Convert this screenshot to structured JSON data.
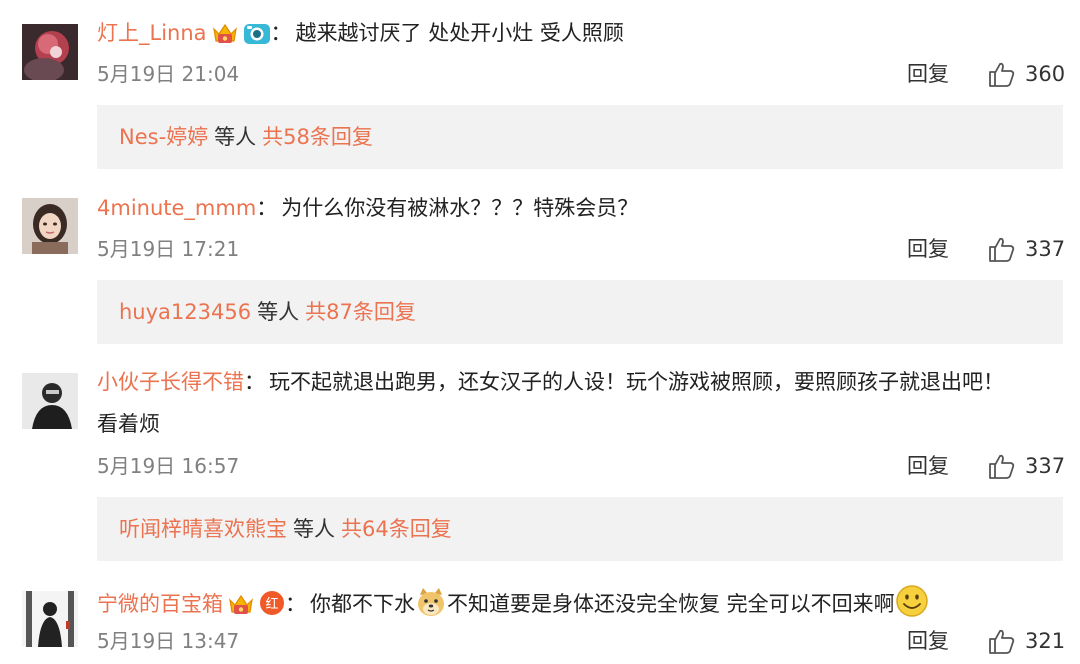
{
  "comments": [
    {
      "username": "灯上_Linna",
      "colon": "：",
      "text": "越来越讨厌了 处处开小灶 受人照顾",
      "timestamp": "5月19日 21:04",
      "reply_label": "回复",
      "likes": "360",
      "badges": [
        "vip-crown-icon",
        "camera-badge-icon"
      ],
      "reply_summary": {
        "user": "Nes-婷婷",
        "middle": "等人",
        "count": "共58条回复"
      }
    },
    {
      "username": "4minute_mmm",
      "colon": "：",
      "text": "为什么你没有被淋水？？？特殊会员？",
      "timestamp": "5月19日 17:21",
      "reply_label": "回复",
      "likes": "337",
      "badges": [],
      "reply_summary": {
        "user": "huya123456",
        "middle": "等人",
        "count": "共87条回复"
      }
    },
    {
      "username": "小伙子长得不错",
      "colon": "：",
      "text": "玩不起就退出跑男，还女汉子的人设！玩个游戏被照顾，要照顾孩子就退出吧！",
      "text_continued": "看着烦",
      "timestamp": "5月19日 16:57",
      "reply_label": "回复",
      "likes": "337",
      "badges": [],
      "reply_summary": {
        "user": "听闻梓晴喜欢熊宝",
        "middle": "等人",
        "count": "共64条回复"
      }
    },
    {
      "username": "宁微的百宝箱",
      "colon": "：",
      "text_part1": "你都不下水",
      "text_part2": "不知道要是身体还没完全恢复 完全可以不回来啊",
      "timestamp": "5月19日 13:47",
      "reply_label": "回复",
      "likes": "321",
      "badges": [
        "vip-crown-icon",
        "red-badge-icon"
      ],
      "red_badge_text": "红",
      "emojis": [
        "doge-emoji-icon",
        "smile-emoji-icon"
      ]
    }
  ],
  "colors": {
    "username": "#eb7350",
    "timestamp": "#808080",
    "reply_box_bg": "#f2f2f2"
  }
}
